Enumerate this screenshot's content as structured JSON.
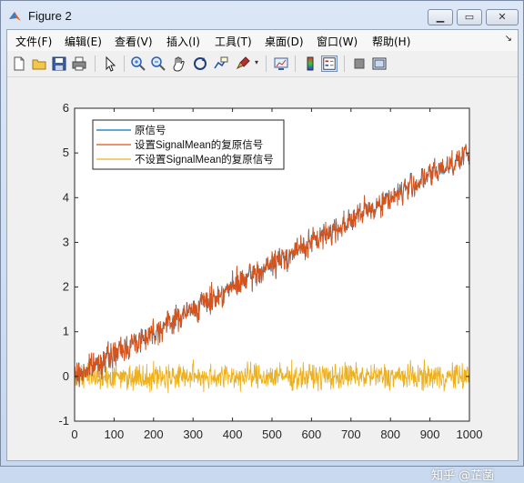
{
  "window": {
    "title": "Figure 2"
  },
  "menu": [
    {
      "label": "文件(F)"
    },
    {
      "label": "编辑(E)"
    },
    {
      "label": "查看(V)"
    },
    {
      "label": "插入(I)"
    },
    {
      "label": "工具(T)"
    },
    {
      "label": "桌面(D)"
    },
    {
      "label": "窗口(W)"
    },
    {
      "label": "帮助(H)"
    }
  ],
  "toolbar_icons": [
    "new-figure",
    "open-file",
    "save",
    "print",
    "pointer",
    "zoom-in",
    "zoom-out",
    "pan",
    "rotate-3d",
    "data-cursor",
    "brush",
    "link-plot",
    "colorbar",
    "legend",
    "hide-plot-tools",
    "show-plot-tools"
  ],
  "watermark": "知乎 @芷菡",
  "chart_data": {
    "type": "line",
    "title": "",
    "xlabel": "",
    "ylabel": "",
    "xlim": [
      0,
      1000
    ],
    "ylim": [
      -1,
      6
    ],
    "xticks": [
      0,
      100,
      200,
      300,
      400,
      500,
      600,
      700,
      800,
      900,
      1000
    ],
    "yticks": [
      -1,
      0,
      1,
      2,
      3,
      4,
      5,
      6
    ],
    "legend_position": "top-left",
    "grid": false,
    "series": [
      {
        "name": "原信号",
        "color": "#0072bd",
        "trend": {
          "x": [
            0,
            1000
          ],
          "y": [
            0,
            5
          ]
        },
        "noise_amplitude": 0.25
      },
      {
        "name": "设置SignalMean的复原信号",
        "color": "#d95319",
        "trend": {
          "x": [
            0,
            1000
          ],
          "y": [
            0,
            5
          ]
        },
        "noise_amplitude": 0.25
      },
      {
        "name": "不设置SignalMean的复原信号",
        "color": "#edb120",
        "trend": {
          "x": [
            0,
            1000
          ],
          "y": [
            0,
            0
          ]
        },
        "noise_amplitude": 0.25
      }
    ]
  }
}
